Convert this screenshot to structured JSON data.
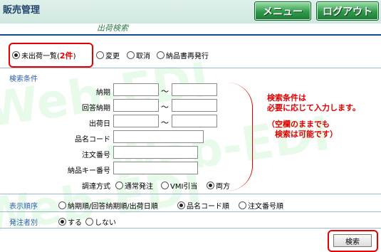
{
  "header": {
    "app_title": "販売管理",
    "menu_label": "メニュー",
    "logout_label": "ログアウト"
  },
  "page": {
    "subtitle": "出荷検索"
  },
  "mode_options": [
    {
      "label": "未出荷一覧(",
      "count": "2件",
      "suffix": ")",
      "selected": true
    },
    {
      "label": "変更",
      "selected": false
    },
    {
      "label": "取消",
      "selected": false
    },
    {
      "label": "納品書再発行",
      "selected": false
    }
  ],
  "search_conditions": {
    "heading": "検索条件",
    "range_separator": "～",
    "fields": [
      {
        "label": "納期",
        "value": "",
        "to_value": ""
      },
      {
        "label": "回答納期",
        "value": "",
        "to_value": ""
      },
      {
        "label": "出荷日",
        "value": "",
        "to_value": ""
      },
      {
        "label": "品名コード",
        "value": ""
      },
      {
        "label": "注文番号",
        "value": ""
      },
      {
        "label": "納品キー番号",
        "value": ""
      }
    ],
    "procurement": {
      "label": "調達方式",
      "options": [
        {
          "label": "通常発注",
          "selected": false
        },
        {
          "label": "VMI引当",
          "selected": false
        },
        {
          "label": "両方",
          "selected": true
        }
      ]
    }
  },
  "annotation": {
    "line1": "検索条件は",
    "line2": "必要に応じて入力します。",
    "line3": "（空欄のままでも",
    "line4": "検索は可能です）"
  },
  "display_order": {
    "label": "表示順序",
    "options": [
      {
        "label": "納期順/回答納期順/出荷日順",
        "selected": false
      },
      {
        "label": "品名コード順",
        "selected": true
      },
      {
        "label": "注文番号順",
        "selected": false
      }
    ]
  },
  "orderer": {
    "label": "発注者別",
    "options": [
      {
        "label": "する",
        "selected": true
      },
      {
        "label": "しない",
        "selected": false
      }
    ]
  },
  "search_button_label": "検索",
  "watermark": "Web-EDI",
  "colors": {
    "header_bg": "#d6ede5",
    "divider": "#0c4f8c",
    "button_green": "#2f9a4a",
    "highlight_red": "#e60000",
    "section_blue": "#2a5db0"
  }
}
